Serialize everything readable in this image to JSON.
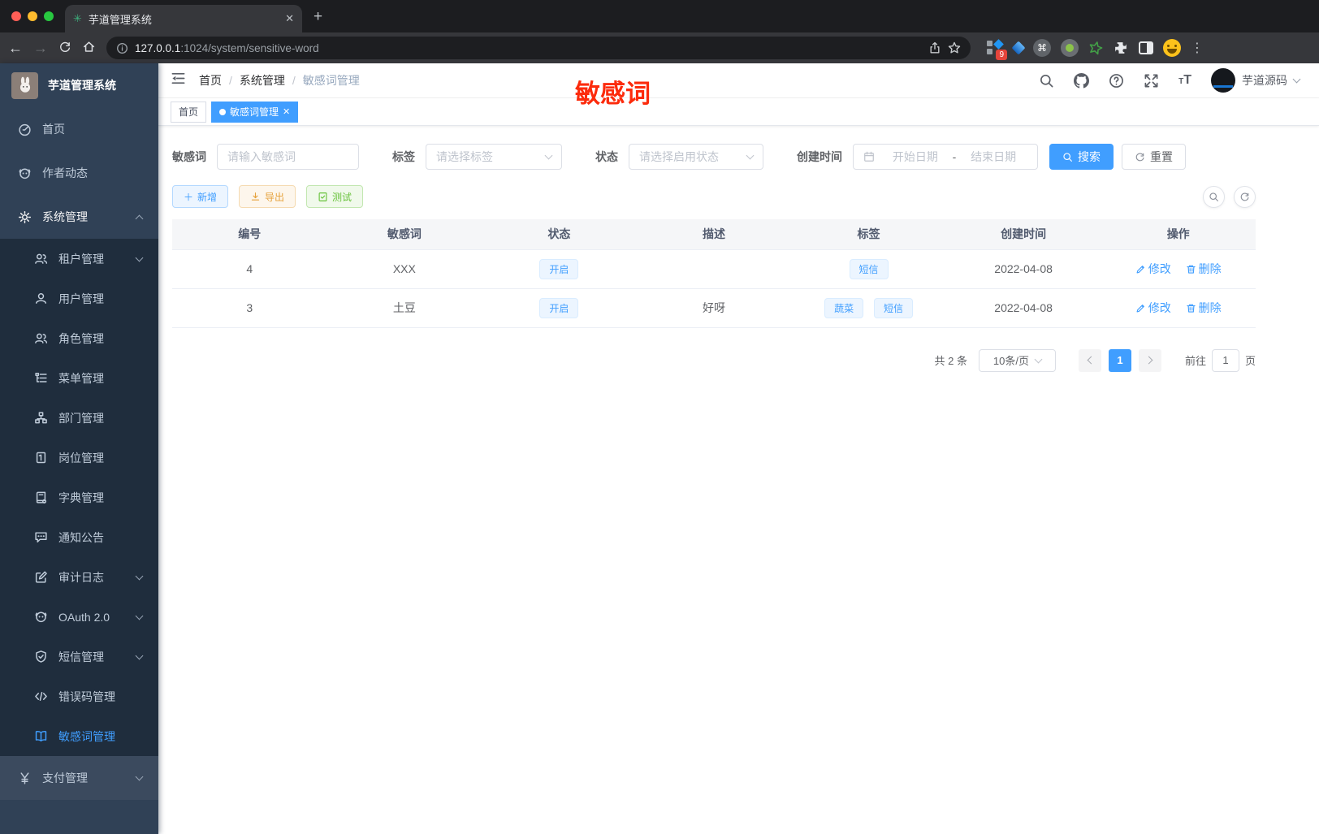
{
  "colors": {
    "primary": "#409eff",
    "annotation_red": "#fc2b0c",
    "export_orange": "#e6a23c",
    "test_green": "#67c23a",
    "sidebar_bg": "#304156",
    "submenu_bg": "#1f2d3d"
  },
  "browser": {
    "tab_title": "芋道管理系统",
    "url_host": "127.0.0.1",
    "url_path": ":1024/system/sensitive-word",
    "extension_badge": "9"
  },
  "sidebar": {
    "title": "芋道管理系统",
    "items": [
      {
        "label": "首页"
      },
      {
        "label": "作者动态"
      },
      {
        "label": "系统管理"
      },
      {
        "label": "租户管理"
      },
      {
        "label": "用户管理"
      },
      {
        "label": "角色管理"
      },
      {
        "label": "菜单管理"
      },
      {
        "label": "部门管理"
      },
      {
        "label": "岗位管理"
      },
      {
        "label": "字典管理"
      },
      {
        "label": "通知公告"
      },
      {
        "label": "审计日志"
      },
      {
        "label": "OAuth 2.0"
      },
      {
        "label": "短信管理"
      },
      {
        "label": "错误码管理"
      },
      {
        "label": "敏感词管理"
      },
      {
        "label": "支付管理"
      }
    ]
  },
  "header": {
    "breadcrumb": [
      "首页",
      "系统管理",
      "敏感词管理"
    ],
    "separator": "/",
    "annotation": "敏感词",
    "username": "芋道源码"
  },
  "tags": [
    {
      "label": "首页"
    },
    {
      "label": "敏感词管理"
    }
  ],
  "filters": {
    "keyword_label": "敏感词",
    "keyword_placeholder": "请输入敏感词",
    "tag_label": "标签",
    "tag_placeholder": "请选择标签",
    "status_label": "状态",
    "status_placeholder": "请选择启用状态",
    "date_label": "创建时间",
    "date_start": "开始日期",
    "date_separator": "-",
    "date_end": "结束日期",
    "search": "搜索",
    "reset": "重置"
  },
  "toolbar": {
    "add": "新增",
    "export": "导出",
    "test": "测试"
  },
  "table": {
    "columns": [
      "编号",
      "敏感词",
      "状态",
      "描述",
      "标签",
      "创建时间",
      "操作"
    ],
    "rows": [
      {
        "id": "4",
        "word": "XXX",
        "status": "开启",
        "description": "",
        "tags": [
          "短信"
        ],
        "created": "2022-04-08"
      },
      {
        "id": "3",
        "word": "土豆",
        "status": "开启",
        "description": "好呀",
        "tags": [
          "蔬菜",
          "短信"
        ],
        "created": "2022-04-08"
      }
    ],
    "edit": "修改",
    "delete": "删除"
  },
  "pagination": {
    "total": "共 2 条",
    "size": "10条/页",
    "page": "1",
    "goto": "前往",
    "goto_value": "1",
    "unit": "页"
  }
}
